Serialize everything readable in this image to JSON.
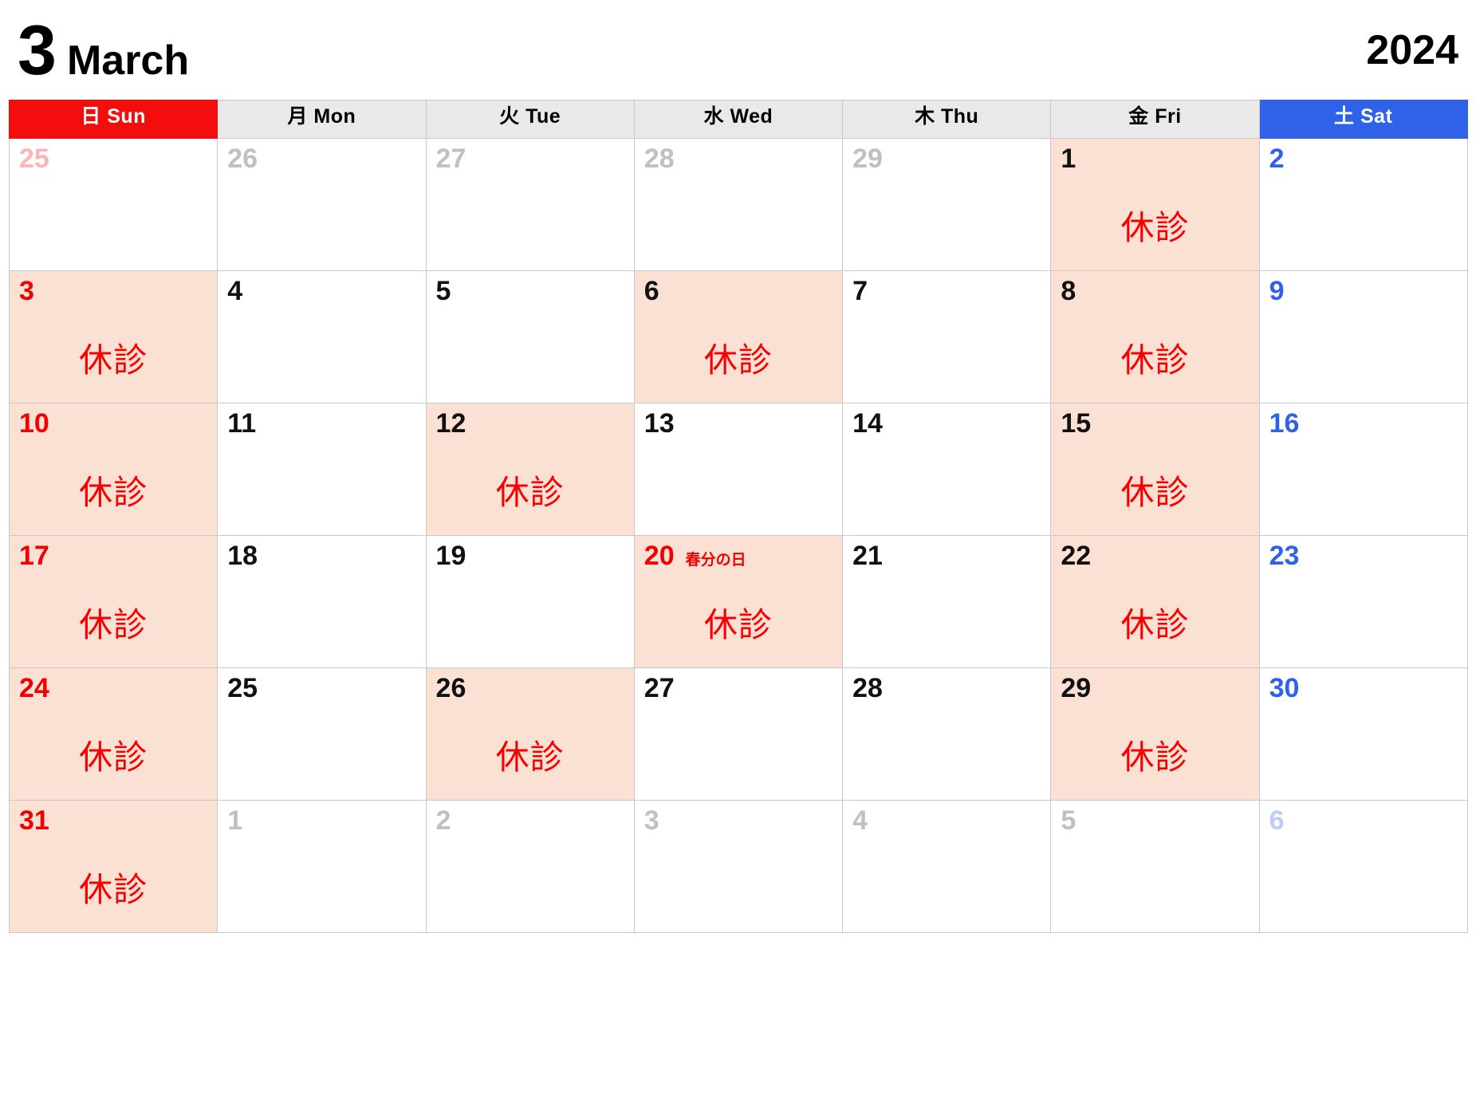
{
  "header": {
    "month_number": "3",
    "month_name": "March",
    "year": "2024"
  },
  "colors": {
    "sunday_header_bg": "#f50d0d",
    "saturday_header_bg": "#2f62e8",
    "weekday_header_bg": "#e9e9e9",
    "closed_cell_bg": "#fbe1d3",
    "closed_text": "#f90000",
    "sunday_date": "#f00000",
    "saturday_date": "#2f62e8",
    "grid_line": "#c9c9c9"
  },
  "weekdays": [
    {
      "id": "sun",
      "label": "日 Sun"
    },
    {
      "id": "mon",
      "label": "月 Mon"
    },
    {
      "id": "tue",
      "label": "火 Tue"
    },
    {
      "id": "wed",
      "label": "水 Wed"
    },
    {
      "id": "thu",
      "label": "木 Thu"
    },
    {
      "id": "fri",
      "label": "金 Fri"
    },
    {
      "id": "sat",
      "label": "土 Sat"
    }
  ],
  "closed_label": "休診",
  "weeks": [
    [
      {
        "date": "25",
        "in_month": false,
        "closed": false,
        "holiday": ""
      },
      {
        "date": "26",
        "in_month": false,
        "closed": false,
        "holiday": ""
      },
      {
        "date": "27",
        "in_month": false,
        "closed": false,
        "holiday": ""
      },
      {
        "date": "28",
        "in_month": false,
        "closed": false,
        "holiday": ""
      },
      {
        "date": "29",
        "in_month": false,
        "closed": false,
        "holiday": ""
      },
      {
        "date": "1",
        "in_month": true,
        "closed": true,
        "holiday": ""
      },
      {
        "date": "2",
        "in_month": true,
        "closed": false,
        "holiday": ""
      }
    ],
    [
      {
        "date": "3",
        "in_month": true,
        "closed": true,
        "holiday": ""
      },
      {
        "date": "4",
        "in_month": true,
        "closed": false,
        "holiday": ""
      },
      {
        "date": "5",
        "in_month": true,
        "closed": false,
        "holiday": ""
      },
      {
        "date": "6",
        "in_month": true,
        "closed": true,
        "holiday": ""
      },
      {
        "date": "7",
        "in_month": true,
        "closed": false,
        "holiday": ""
      },
      {
        "date": "8",
        "in_month": true,
        "closed": true,
        "holiday": ""
      },
      {
        "date": "9",
        "in_month": true,
        "closed": false,
        "holiday": ""
      }
    ],
    [
      {
        "date": "10",
        "in_month": true,
        "closed": true,
        "holiday": ""
      },
      {
        "date": "11",
        "in_month": true,
        "closed": false,
        "holiday": ""
      },
      {
        "date": "12",
        "in_month": true,
        "closed": true,
        "holiday": ""
      },
      {
        "date": "13",
        "in_month": true,
        "closed": false,
        "holiday": ""
      },
      {
        "date": "14",
        "in_month": true,
        "closed": false,
        "holiday": ""
      },
      {
        "date": "15",
        "in_month": true,
        "closed": true,
        "holiday": ""
      },
      {
        "date": "16",
        "in_month": true,
        "closed": false,
        "holiday": ""
      }
    ],
    [
      {
        "date": "17",
        "in_month": true,
        "closed": true,
        "holiday": ""
      },
      {
        "date": "18",
        "in_month": true,
        "closed": false,
        "holiday": ""
      },
      {
        "date": "19",
        "in_month": true,
        "closed": false,
        "holiday": ""
      },
      {
        "date": "20",
        "in_month": true,
        "closed": true,
        "holiday": "春分の日"
      },
      {
        "date": "21",
        "in_month": true,
        "closed": false,
        "holiday": ""
      },
      {
        "date": "22",
        "in_month": true,
        "closed": true,
        "holiday": ""
      },
      {
        "date": "23",
        "in_month": true,
        "closed": false,
        "holiday": ""
      }
    ],
    [
      {
        "date": "24",
        "in_month": true,
        "closed": true,
        "holiday": ""
      },
      {
        "date": "25",
        "in_month": true,
        "closed": false,
        "holiday": ""
      },
      {
        "date": "26",
        "in_month": true,
        "closed": true,
        "holiday": ""
      },
      {
        "date": "27",
        "in_month": true,
        "closed": false,
        "holiday": ""
      },
      {
        "date": "28",
        "in_month": true,
        "closed": false,
        "holiday": ""
      },
      {
        "date": "29",
        "in_month": true,
        "closed": true,
        "holiday": ""
      },
      {
        "date": "30",
        "in_month": true,
        "closed": false,
        "holiday": ""
      }
    ],
    [
      {
        "date": "31",
        "in_month": true,
        "closed": true,
        "holiday": ""
      },
      {
        "date": "1",
        "in_month": false,
        "closed": false,
        "holiday": ""
      },
      {
        "date": "2",
        "in_month": false,
        "closed": false,
        "holiday": ""
      },
      {
        "date": "3",
        "in_month": false,
        "closed": false,
        "holiday": ""
      },
      {
        "date": "4",
        "in_month": false,
        "closed": false,
        "holiday": ""
      },
      {
        "date": "5",
        "in_month": false,
        "closed": false,
        "holiday": ""
      },
      {
        "date": "6",
        "in_month": false,
        "closed": false,
        "holiday": ""
      }
    ]
  ]
}
